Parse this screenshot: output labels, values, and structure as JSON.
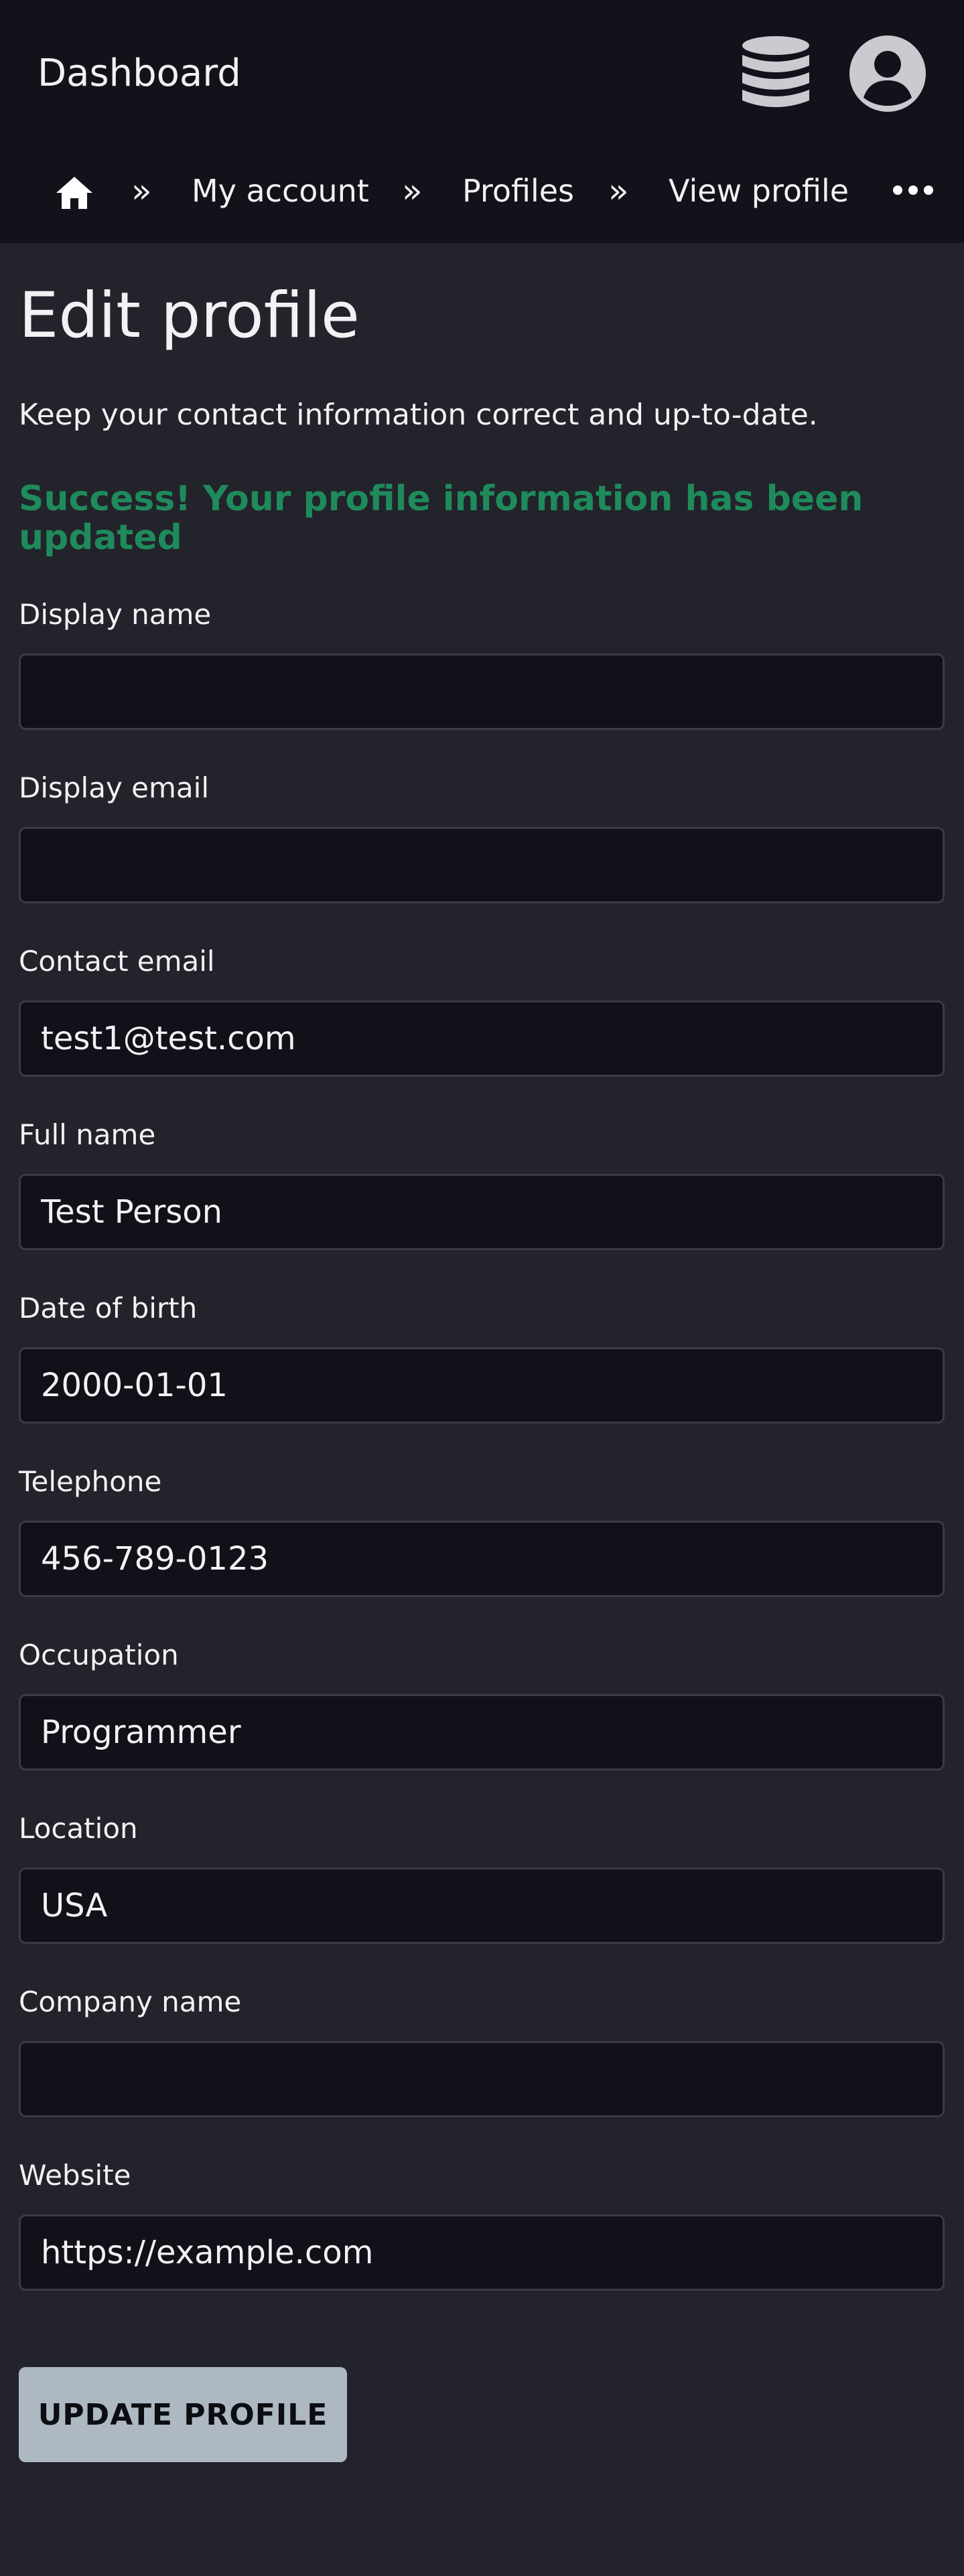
{
  "header": {
    "title": "Dashboard",
    "icons": [
      "database-icon",
      "user-account-icon"
    ]
  },
  "breadcrumb": {
    "home_icon": "home-icon",
    "separator": "»",
    "items": [
      "My account",
      "Profiles",
      "View profile"
    ],
    "more_icon": "more-horizontal-icon"
  },
  "main": {
    "title": "Edit profile",
    "subtitle": "Keep your contact information correct and up-to-date.",
    "success_message": "Success! Your profile information has been updated"
  },
  "form": {
    "fields": [
      {
        "label": "Display name",
        "value": ""
      },
      {
        "label": "Display email",
        "value": ""
      },
      {
        "label": "Contact email",
        "value": "test1@test.com"
      },
      {
        "label": "Full name",
        "value": "Test Person"
      },
      {
        "label": "Date of birth",
        "value": "2000-01-01"
      },
      {
        "label": "Telephone",
        "value": "456-789-0123"
      },
      {
        "label": "Occupation",
        "value": "Programmer"
      },
      {
        "label": "Location",
        "value": "USA"
      },
      {
        "label": "Company name",
        "value": ""
      },
      {
        "label": "Website",
        "value": "https://example.com"
      }
    ],
    "submit_label": "UPDATE PROFILE"
  },
  "colors": {
    "background": "#22232b",
    "header_background": "#12121a",
    "success": "#1f8a5b",
    "button": "#adb8c3"
  }
}
